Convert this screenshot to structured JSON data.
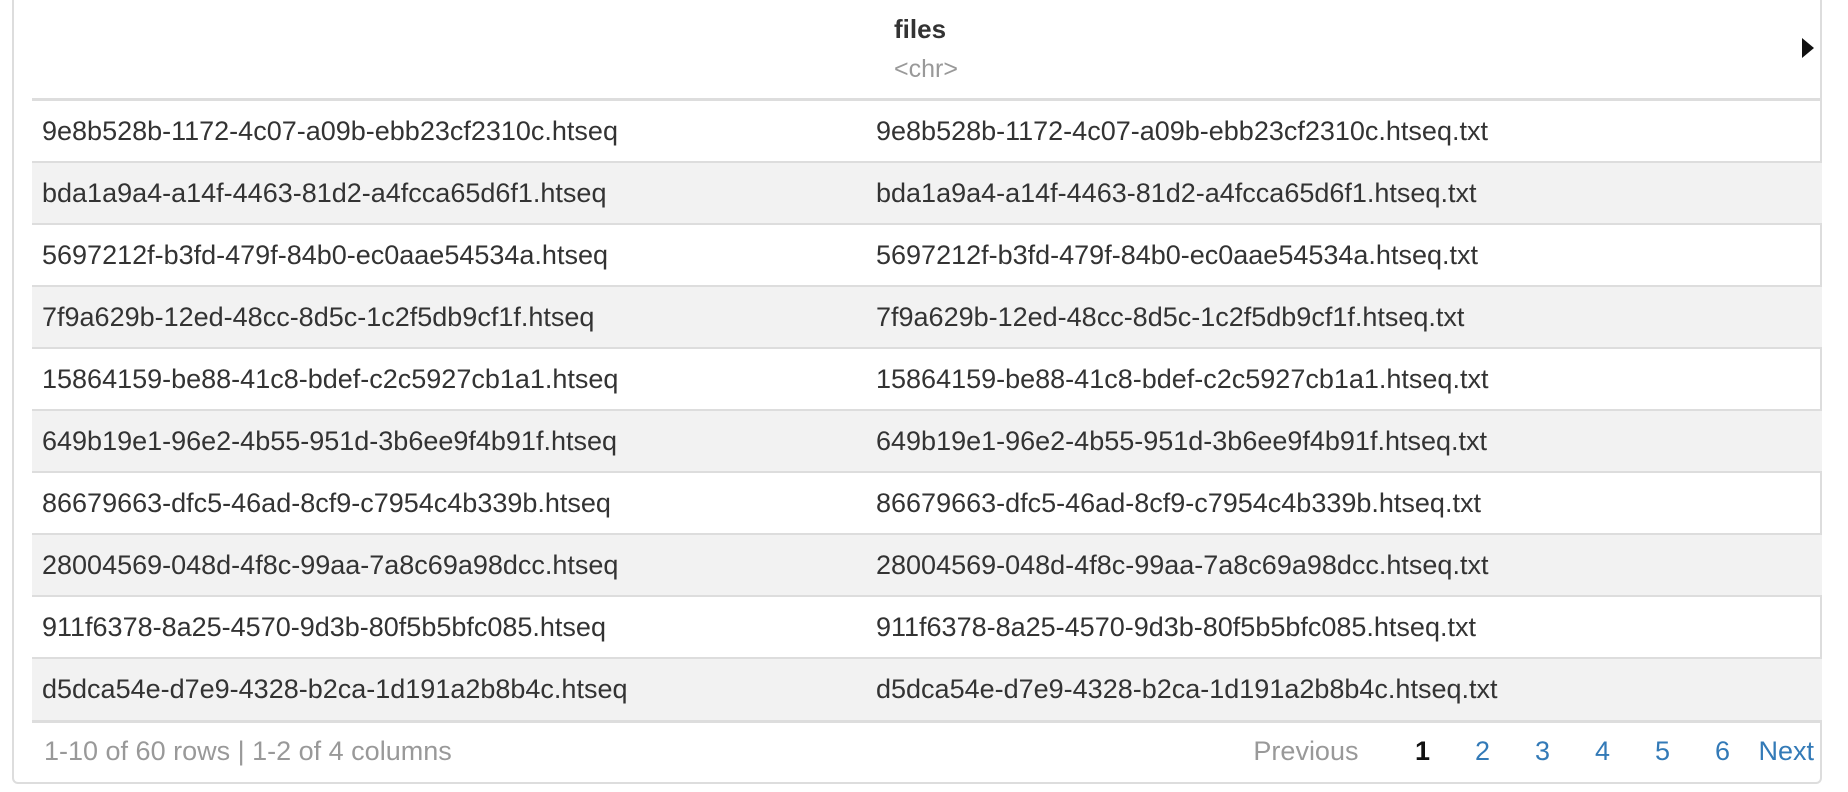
{
  "header": {
    "column_name": "files",
    "column_type": "<chr>"
  },
  "rows": [
    {
      "rowname": "9e8b528b-1172-4c07-a09b-ebb23cf2310c.htseq",
      "files": "9e8b528b-1172-4c07-a09b-ebb23cf2310c.htseq.txt"
    },
    {
      "rowname": "bda1a9a4-a14f-4463-81d2-a4fcca65d6f1.htseq",
      "files": "bda1a9a4-a14f-4463-81d2-a4fcca65d6f1.htseq.txt"
    },
    {
      "rowname": "5697212f-b3fd-479f-84b0-ec0aae54534a.htseq",
      "files": "5697212f-b3fd-479f-84b0-ec0aae54534a.htseq.txt"
    },
    {
      "rowname": "7f9a629b-12ed-48cc-8d5c-1c2f5db9cf1f.htseq",
      "files": "7f9a629b-12ed-48cc-8d5c-1c2f5db9cf1f.htseq.txt"
    },
    {
      "rowname": "15864159-be88-41c8-bdef-c2c5927cb1a1.htseq",
      "files": "15864159-be88-41c8-bdef-c2c5927cb1a1.htseq.txt"
    },
    {
      "rowname": "649b19e1-96e2-4b55-951d-3b6ee9f4b91f.htseq",
      "files": "649b19e1-96e2-4b55-951d-3b6ee9f4b91f.htseq.txt"
    },
    {
      "rowname": "86679663-dfc5-46ad-8cf9-c7954c4b339b.htseq",
      "files": "86679663-dfc5-46ad-8cf9-c7954c4b339b.htseq.txt"
    },
    {
      "rowname": "28004569-048d-4f8c-99aa-7a8c69a98dcc.htseq",
      "files": "28004569-048d-4f8c-99aa-7a8c69a98dcc.htseq.txt"
    },
    {
      "rowname": "911f6378-8a25-4570-9d3b-80f5b5bfc085.htseq",
      "files": "911f6378-8a25-4570-9d3b-80f5b5bfc085.htseq.txt"
    },
    {
      "rowname": "d5dca54e-d7e9-4328-b2ca-1d191a2b8b4c.htseq",
      "files": "d5dca54e-d7e9-4328-b2ca-1d191a2b8b4c.htseq.txt"
    }
  ],
  "footer": {
    "summary": "1-10 of 60 rows | 1-2 of 4 columns",
    "previous_label": "Previous",
    "next_label": "Next",
    "pages": [
      "1",
      "2",
      "3",
      "4",
      "5",
      "6"
    ],
    "current_page": "1"
  },
  "icons": {
    "expand_columns": "caret-right-icon"
  }
}
